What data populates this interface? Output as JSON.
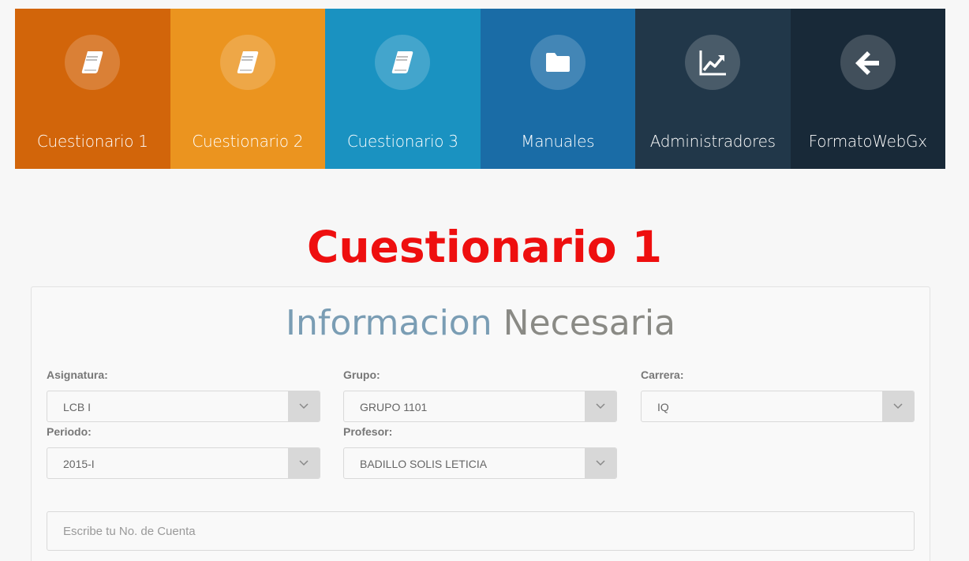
{
  "nav": {
    "tiles": [
      {
        "label": "Cuestionario 1",
        "icon": "book-icon",
        "color": "#d2650a"
      },
      {
        "label": "Cuestionario 2",
        "icon": "book-icon",
        "color": "#eb941f"
      },
      {
        "label": "Cuestionario 3",
        "icon": "book-icon",
        "color": "#1a92c1"
      },
      {
        "label": "Manuales",
        "icon": "folder-icon",
        "color": "#1a6ca6"
      },
      {
        "label": "Administradores",
        "icon": "line-chart-icon",
        "color": "#213749"
      },
      {
        "label": "FormatoWebGx",
        "icon": "arrow-left-icon",
        "color": "#182938"
      }
    ]
  },
  "page": {
    "title": "Cuestionario 1",
    "title_color": "#ee0f0f"
  },
  "panel": {
    "title_part1": "Informacion",
    "title_part2": "Necesaria",
    "title_part1_color": "#7a9db4",
    "title_part2_color": "#8a8a85"
  },
  "form": {
    "asignatura": {
      "label": "Asignatura:",
      "value": "LCB I"
    },
    "grupo": {
      "label": "Grupo:",
      "value": "GRUPO 1101"
    },
    "carrera": {
      "label": "Carrera:",
      "value": "IQ"
    },
    "periodo": {
      "label": "Periodo:",
      "value": "2015-I"
    },
    "profesor": {
      "label": "Profesor:",
      "value": "BADILLO SOLIS LETICIA"
    },
    "cuenta": {
      "placeholder": "Escribe tu No. de Cuenta",
      "value": ""
    }
  }
}
